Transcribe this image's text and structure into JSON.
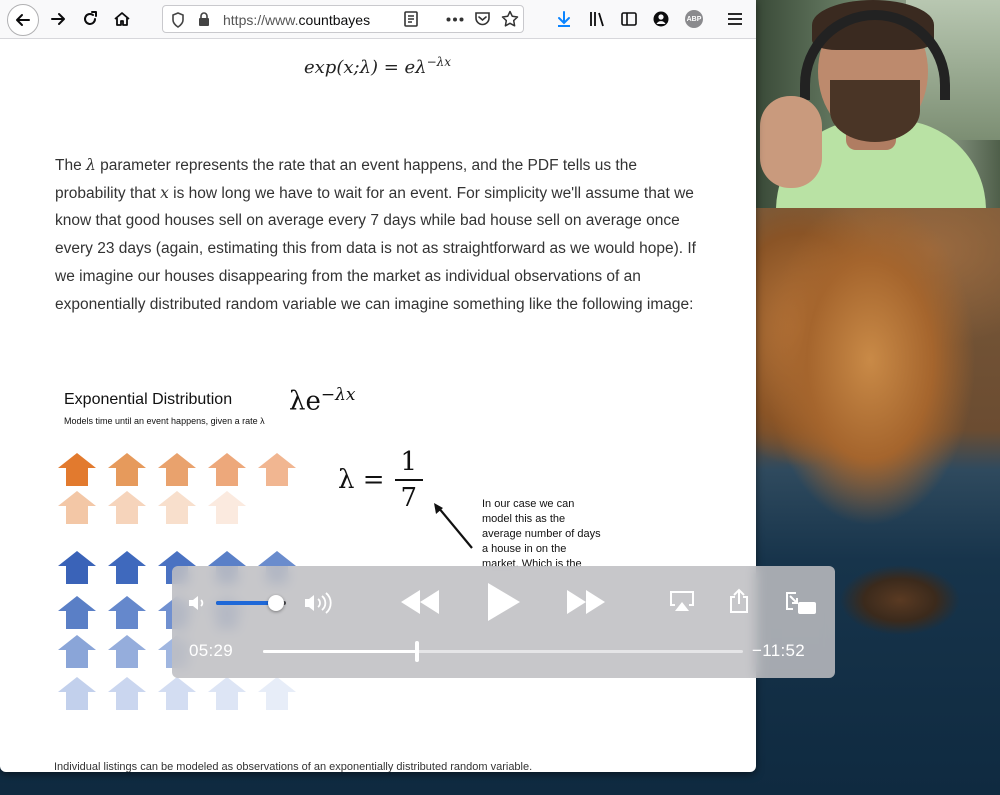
{
  "browser": {
    "url_prefix": "https://www.",
    "url_host": "countbayesie.",
    "icons": [
      "back-icon",
      "forward-icon",
      "reload-icon",
      "home-icon",
      "shield-icon",
      "lock-icon",
      "reader-icon",
      "more-icon",
      "pocket-icon",
      "star-icon",
      "download-icon",
      "library-icon",
      "sidebar-icon",
      "account-icon",
      "adblock-icon",
      "menu-icon"
    ],
    "adblock_label": "ABP"
  },
  "article": {
    "formula_top": "exp(x;λ) = eλ",
    "formula_top_exp": "−λx",
    "p1_a": "The ",
    "p1_lambda": "λ",
    "p1_b": " parameter represents the rate that an event happens, and the PDF tells us the probability that ",
    "p1_x": "x",
    "p1_c": " is how long we have to wait for an event. For simplicity we'll assume that we know that good houses sell on average every 7 days while bad house sell on average once every 23 days (again, estimating this from data is not as straightforward as we would hope). If we imagine our houses disappearing from the market as individual observations of an exponentially distributed random variable we can imagine something like the following image:"
  },
  "figure": {
    "title": "Exponential Distribution",
    "subtitle": "Models time until an event happens, given a rate λ",
    "eq1_base": "λe",
    "eq1_exp": "−λx",
    "eq2_lhs": "λ =",
    "eq2_num": "1",
    "eq2_den": "7",
    "annotation": "In our case we can model this as the average number of days a house in on the market. Which is the",
    "caption": "Individual listings can be modeled as observations of an exponentially distributed random variable.",
    "orange_rows": [
      [
        "#e27a2e",
        "#e69a5c",
        "#e9a26d",
        "#eda87b",
        "#f1b691"
      ],
      [
        "#f3c7a6",
        "#f6d4bb",
        "#f8dfcc",
        "#fbeadf"
      ]
    ],
    "blue_rows": [
      [
        "#3a63b8",
        "#3f69bd",
        "#4a72c2",
        "#5a80c8",
        "#6a8ccd"
      ],
      [
        "#5a7fc6",
        "#6588cc",
        "#7090d0",
        "#7c99d4"
      ],
      [
        "#8aa5d8",
        "#95addc",
        "#a0b6e0"
      ],
      [
        "#c2d0ec",
        "#cad6ef",
        "#d3ddf2",
        "#dde5f5",
        "#e7edf8"
      ]
    ]
  },
  "video": {
    "elapsed": "05:29",
    "remaining": "−11:52",
    "volume_level": 0.85,
    "progress": 0.32,
    "icons": [
      "volume-low-icon",
      "volume-high-icon",
      "rewind-icon",
      "play-icon",
      "fast-forward-icon",
      "airplay-icon",
      "share-icon",
      "picture-in-picture-icon"
    ]
  }
}
